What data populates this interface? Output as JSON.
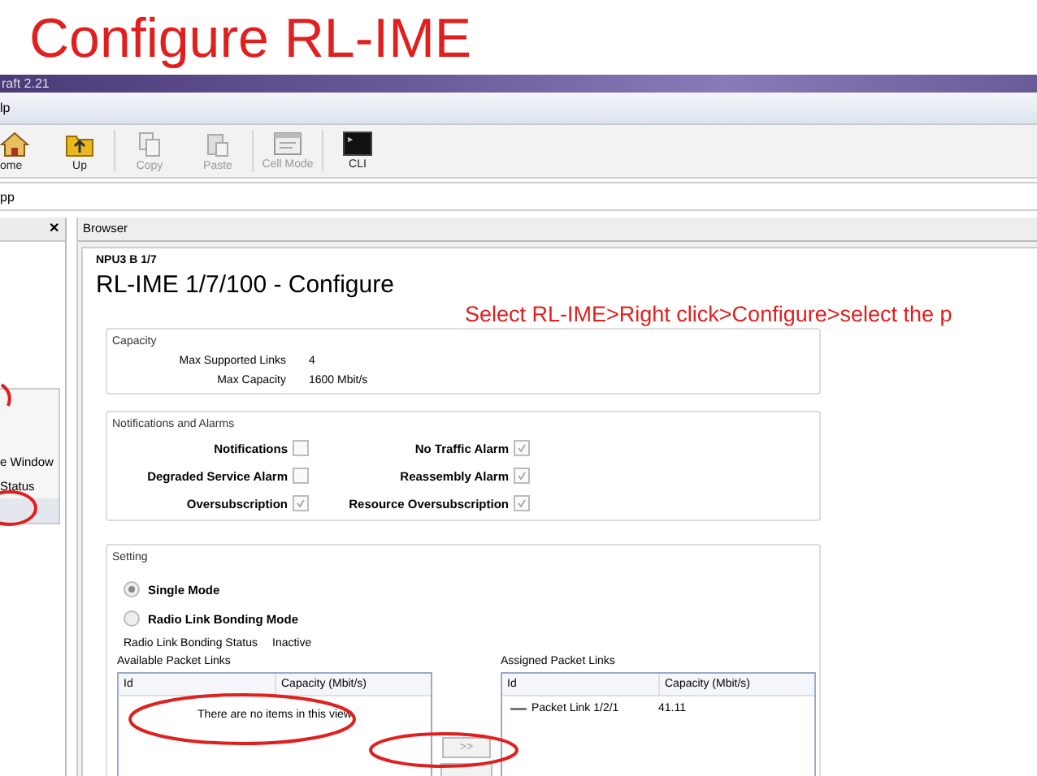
{
  "slide_title": "Configure RL-IME",
  "window": {
    "title": "raft 2.21"
  },
  "menu": [
    "lp"
  ],
  "toolbar": [
    {
      "kind": "home",
      "label": "ome",
      "disabled": false
    },
    {
      "kind": "up",
      "label": "Up",
      "disabled": false
    },
    {
      "kind": "copy",
      "label": "Copy",
      "disabled": true
    },
    {
      "kind": "paste",
      "label": "Paste",
      "disabled": true
    },
    {
      "kind": "cellmode",
      "label": "Cell Mode",
      "disabled": true
    },
    {
      "kind": "cli",
      "label": "CLI",
      "disabled": false
    }
  ],
  "address": "pp",
  "left_panel": {
    "close": "✕",
    "items": [
      {
        "label": "e Window",
        "selected": false
      },
      {
        "label": "Status",
        "selected": false
      },
      {
        "selected": true
      }
    ]
  },
  "browser": {
    "tab": "Browser",
    "breadcrumb": "NPU3 B 1/7",
    "title": "RL-IME 1/7/100 - Configure",
    "instruction": "Select RL-IME>Right click>Configure>select the p",
    "capacity": {
      "legend": "Capacity",
      "rows": [
        {
          "label": "Max Supported Links",
          "value": "4"
        },
        {
          "label": "Max Capacity",
          "value": "1600 Mbit/s"
        }
      ]
    },
    "notifications": {
      "legend": "Notifications and Alarms",
      "items": [
        {
          "label": "Notifications",
          "checked": false
        },
        {
          "label": "No Traffic Alarm",
          "checked": true
        },
        {
          "label": "Degraded Service Alarm",
          "checked": false
        },
        {
          "label": "Reassembly Alarm",
          "checked": true
        },
        {
          "label": "Oversubscription",
          "checked": true
        },
        {
          "label": "Resource Oversubscription",
          "checked": true
        }
      ]
    },
    "setting": {
      "legend": "Setting",
      "modes": [
        {
          "label": "Single Mode",
          "selected": true
        },
        {
          "label": "Radio Link Bonding Mode",
          "selected": false
        }
      ],
      "status_label": "Radio Link Bonding Status",
      "status_value": "Inactive",
      "available": {
        "label": "Available Packet Links",
        "columns": [
          "Id",
          "Capacity (Mbit/s)"
        ],
        "empty": "There are no items in this view"
      },
      "move_button": ">>",
      "assigned": {
        "label": "Assigned Packet Links",
        "columns": [
          "Id",
          "Capacity (Mbit/s)"
        ],
        "rows": [
          {
            "id": "Packet Link 1/2/1",
            "capacity": "41.11"
          }
        ]
      }
    }
  }
}
